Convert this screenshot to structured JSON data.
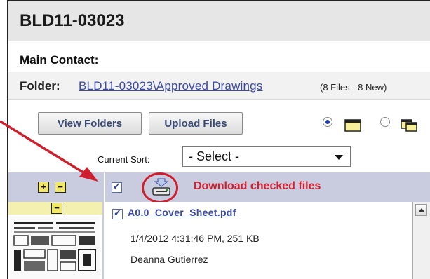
{
  "header": {
    "title": "BLD11-03023"
  },
  "contact": {
    "label": "Main Contact:"
  },
  "folder": {
    "label": "Folder:",
    "link": "BLD11-03023\\Approved Drawings",
    "count": "(8 Files - 8 New)"
  },
  "toolbar": {
    "view_folders": "View Folders",
    "upload_files": "Upload Files"
  },
  "sort": {
    "label": "Current Sort:",
    "selected": "- Select -"
  },
  "list": {
    "expand": "+",
    "collapse": "−",
    "download_annotation": "Download checked files",
    "thumb_toggle": "−"
  },
  "file": {
    "name": "A0.0_Cover_Sheet.pdf",
    "meta": "1/4/2012 4:31:46 PM, 251 KB",
    "user": "Deanna Gutierrez"
  },
  "colors": {
    "annotation_red": "#cf1f2e",
    "link_blue": "#3b4aa6",
    "list_header_bg": "#c9ccdf"
  }
}
